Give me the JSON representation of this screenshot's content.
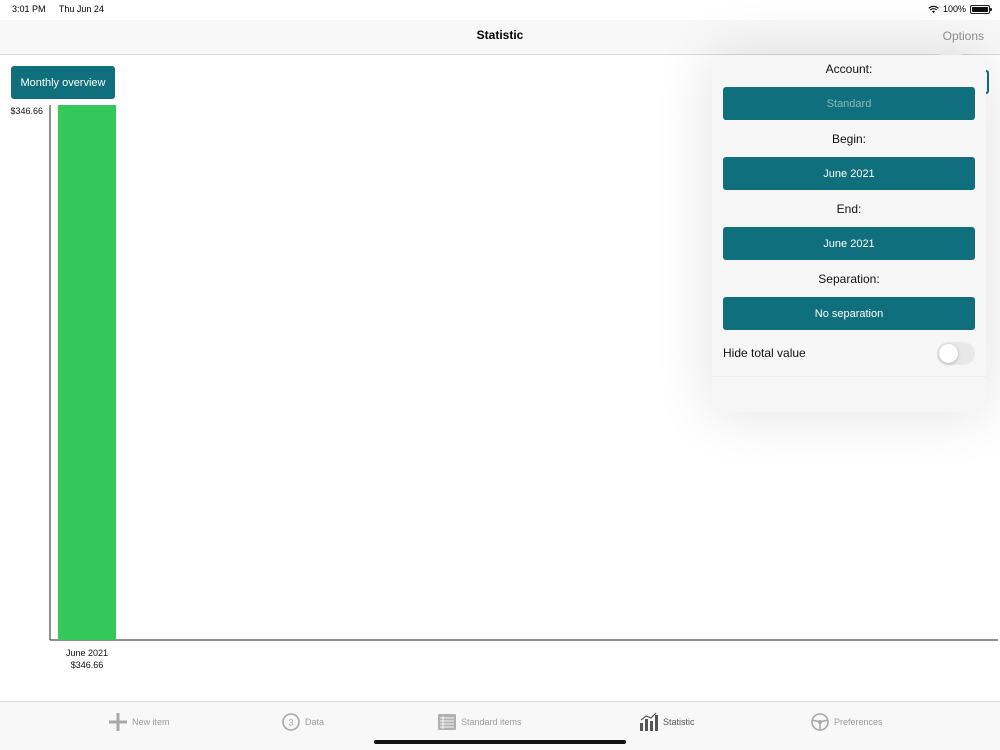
{
  "status_bar": {
    "time": "3:01 PM",
    "date": "Thu Jun 24",
    "battery": "100%"
  },
  "nav": {
    "title": "Statistic",
    "options_label": "Options"
  },
  "overview_button": "Monthly overview",
  "chart_data": {
    "type": "bar",
    "categories": [
      "June 2021"
    ],
    "values": [
      346.66
    ],
    "value_labels": [
      "$346.66"
    ],
    "y_max_label": "$346.66",
    "ylim": [
      0,
      346.66
    ],
    "bar_color": "#34c759",
    "grid": false
  },
  "popover": {
    "account_label": "Account:",
    "account_value": "Standard",
    "begin_label": "Begin:",
    "begin_value": "June 2021",
    "end_label": "End:",
    "end_value": "June 2021",
    "separation_label": "Separation:",
    "separation_value": "No separation",
    "hide_total_label": "Hide total value",
    "hide_total_on": false
  },
  "tabs": [
    {
      "label": "New item",
      "icon": "plus-icon"
    },
    {
      "label": "Data",
      "icon": "numbered-circle-icon",
      "badge": "3"
    },
    {
      "label": "Standard items",
      "icon": "list-icon"
    },
    {
      "label": "Statistic",
      "icon": "chart-icon"
    },
    {
      "label": "Preferences",
      "icon": "steering-wheel-icon"
    }
  ],
  "colors": {
    "accent": "#0f6f7c",
    "bar": "#34c759"
  }
}
